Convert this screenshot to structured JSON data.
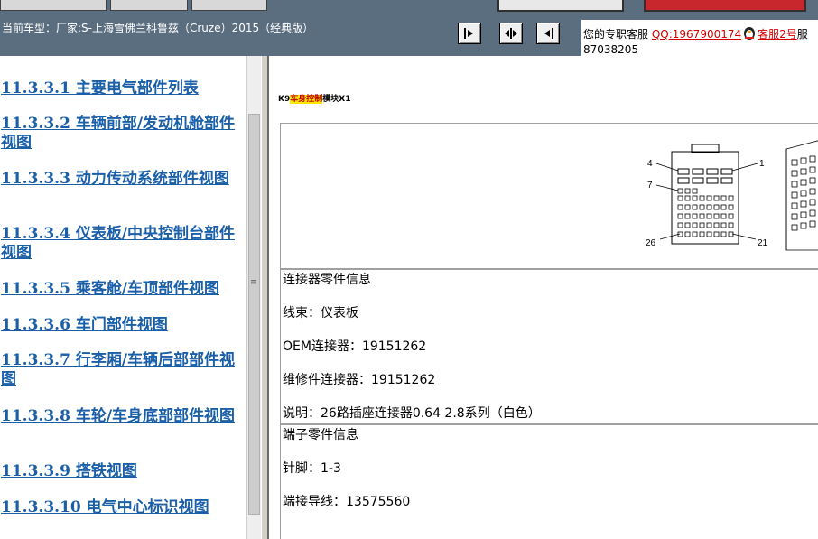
{
  "header": {
    "car_model": "当前车型：厂家:S-上海雪佛兰科鲁兹（Cruze）2015（经典版）"
  },
  "service": {
    "line1_prefix": "您的专职客服",
    "qq_link": "QQ:1967900174",
    "kefu_link": "客服2号",
    "tail": "服",
    "line2": "87038205"
  },
  "toc": {
    "items": [
      {
        "label": "11.3.3.1 主要电气部件列表"
      },
      {
        "label": "11.3.3.2 车辆前部/发动机舱部件视图"
      },
      {
        "label": "11.3.3.3 动力传动系统部件视图"
      },
      {
        "label": "11.3.3.4 仪表板/中央控制台部件视图"
      },
      {
        "label": "11.3.3.5 乘客舱/车顶部件视图"
      },
      {
        "label": "11.3.3.6 车门部件视图"
      },
      {
        "label": "11.3.3.7 行李厢/车辆后部部件视图"
      },
      {
        "label": "11.3.3.8 车轮/车身底部部件视图"
      },
      {
        "label": "11.3.3.9 搭铁视图"
      },
      {
        "label": "11.3.3.10 电气中心标识视图"
      }
    ]
  },
  "content": {
    "module_prefix": "K9",
    "module_highlight": "车身控制",
    "module_suffix": "模块X1",
    "figure_labels": {
      "p4": "4",
      "p1": "1",
      "p7": "7",
      "p26": "26",
      "p21": "21"
    },
    "connector_info": [
      "连接器零件信息",
      "线束：仪表板",
      "OEM连接器：19151262",
      "维修件连接器：19151262",
      "说明：26路插座连接器0.64 2.8系列（白色）"
    ],
    "terminal_info": [
      "端子零件信息",
      "针脚：1-3",
      "端接导线：13575560"
    ]
  },
  "colors": {
    "toc_link": "#1a5fa8",
    "header_bg": "#5a6e80",
    "highlight": "#ffe800",
    "qq_red": "#d40000"
  }
}
